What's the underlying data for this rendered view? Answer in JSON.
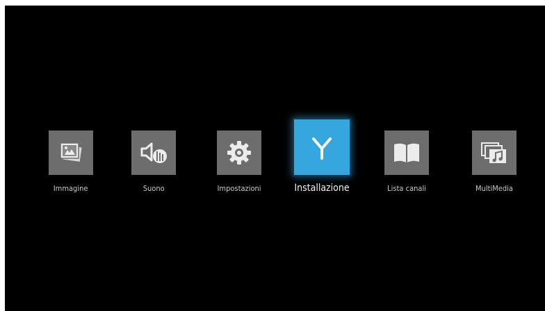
{
  "menu": {
    "items": [
      {
        "label": "Immagine",
        "icon": "picture-icon"
      },
      {
        "label": "Suono",
        "icon": "speaker-icon"
      },
      {
        "label": "Impostazioni",
        "icon": "gear-icon"
      },
      {
        "label": "Installazione",
        "icon": "antenna-icon",
        "selected": true
      },
      {
        "label": "Lista canali",
        "icon": "book-icon"
      },
      {
        "label": "MultiMedia",
        "icon": "media-icon"
      }
    ]
  },
  "colors": {
    "background": "#000000",
    "tile": "#6d6d6d",
    "tile_active": "#35a6de",
    "label": "#c9c9c9"
  }
}
